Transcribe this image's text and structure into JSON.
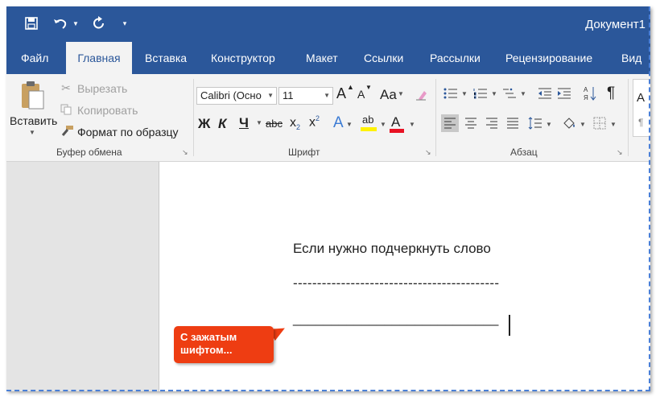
{
  "window": {
    "title": "Документ1"
  },
  "tabs": [
    {
      "label": "Файл"
    },
    {
      "label": "Главная"
    },
    {
      "label": "Вставка"
    },
    {
      "label": "Конструктор"
    },
    {
      "label": "Макет"
    },
    {
      "label": "Ссылки"
    },
    {
      "label": "Рассылки"
    },
    {
      "label": "Рецензирование"
    },
    {
      "label": "Вид"
    }
  ],
  "clipboard": {
    "paste": "Вставить",
    "cut": "Вырезать",
    "copy": "Копировать",
    "format_painter": "Формат по образцу",
    "group": "Буфер обмена"
  },
  "font": {
    "name": "Calibri (Осно",
    "size": "11",
    "grow": "A",
    "shrink": "A",
    "case": "Aa",
    "bold": "Ж",
    "italic": "К",
    "underline": "Ч",
    "strike": "abc",
    "subscript": "x",
    "sub_mark": "2",
    "superscript": "x",
    "sup_mark": "2",
    "effects": "A",
    "highlight": "ab",
    "color": "A",
    "group": "Шрифт"
  },
  "paragraph": {
    "group": "Абзац",
    "pilcrow": "¶"
  },
  "styles": {
    "preview": "А"
  },
  "document": {
    "line1": "Если нужно подчеркнуть слово",
    "line2": "-------------------------------------------",
    "line3": "___________________________"
  },
  "callout": {
    "text": "С зажатым шифтом..."
  },
  "colors": {
    "brand": "#2b579a",
    "callout": "#ee3d12",
    "highlight": "#fff200",
    "font_color": "#e81123"
  },
  "icons": {
    "save": "save-icon",
    "undo": "undo-icon",
    "redo": "redo-icon",
    "customize": "customize-qat-icon"
  }
}
